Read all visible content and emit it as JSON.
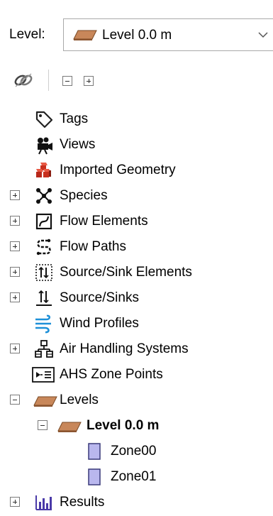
{
  "level_selector": {
    "label": "Level:",
    "selected": "Level 0.0 m"
  },
  "toolbar": {
    "collapse_all": "−",
    "expand_all": "+"
  },
  "tree": [
    {
      "label": "Tags",
      "icon": "tag-icon",
      "expander": "none",
      "depth": 0
    },
    {
      "label": "Views",
      "icon": "camera-icon",
      "expander": "none",
      "depth": 0
    },
    {
      "label": "Imported Geometry",
      "icon": "imported-geometry-icon",
      "expander": "none",
      "depth": 0
    },
    {
      "label": "Species",
      "icon": "species-icon",
      "expander": "plus",
      "depth": 0
    },
    {
      "label": "Flow Elements",
      "icon": "flow-element-icon",
      "expander": "plus",
      "depth": 0
    },
    {
      "label": "Flow Paths",
      "icon": "flow-path-icon",
      "expander": "plus",
      "depth": 0
    },
    {
      "label": "Source/Sink Elements",
      "icon": "source-sink-element-icon",
      "expander": "plus",
      "depth": 0
    },
    {
      "label": "Source/Sinks",
      "icon": "source-sink-icon",
      "expander": "plus",
      "depth": 0
    },
    {
      "label": "Wind Profiles",
      "icon": "wind-icon",
      "expander": "none",
      "depth": 0
    },
    {
      "label": "Air Handling Systems",
      "icon": "ahs-icon",
      "expander": "plus",
      "depth": 0
    },
    {
      "label": "AHS Zone Points",
      "icon": "ahs-zone-point-icon",
      "expander": "none",
      "depth": 0
    },
    {
      "label": "Levels",
      "icon": "level-slab-icon",
      "expander": "minus",
      "depth": 0
    },
    {
      "label": "Level 0.0 m",
      "icon": "level-slab-icon",
      "expander": "minus",
      "depth": 1,
      "bold": true
    },
    {
      "label": "Zone00",
      "icon": "zone-icon",
      "expander": "none",
      "depth": 2
    },
    {
      "label": "Zone01",
      "icon": "zone-icon",
      "expander": "none",
      "depth": 2
    },
    {
      "label": "Results",
      "icon": "results-chart-icon",
      "expander": "plus",
      "depth": 0
    }
  ],
  "colors": {
    "slab": "#c8875a",
    "slab_dark": "#7a4a25",
    "zone_fill": "#b9b7ee",
    "zone_border": "#3a3a7a",
    "wind": "#1e90d8",
    "imported": "#d23c2a"
  }
}
